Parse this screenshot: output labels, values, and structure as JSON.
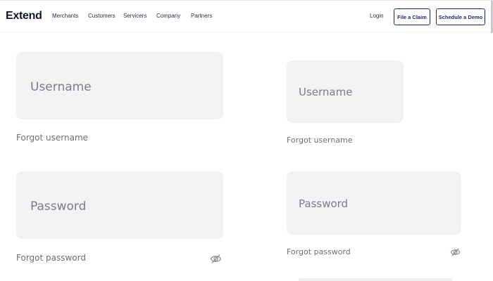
{
  "header": {
    "brand": "Extend",
    "nav": [
      "Merchants",
      "Customers",
      "Servicers",
      "Company",
      "Partners"
    ],
    "login": "Login",
    "file_claim": "File a Claim",
    "schedule_demo": "Schedule a Demo"
  },
  "form_left": {
    "username_placeholder": "Username",
    "forgot_username": "Forgot username",
    "password_placeholder": "Password",
    "forgot_password": "Forgot password"
  },
  "form_right": {
    "username_placeholder": "Username",
    "forgot_username": "Forgot username",
    "password_placeholder": "Password",
    "forgot_password": "Forgot password"
  },
  "icons": {
    "password_toggle": "eye-slash-icon"
  },
  "colors": {
    "brand_navy": "#1e2a78",
    "field_bg": "#f2f1f4",
    "placeholder": "#7c7f86"
  }
}
